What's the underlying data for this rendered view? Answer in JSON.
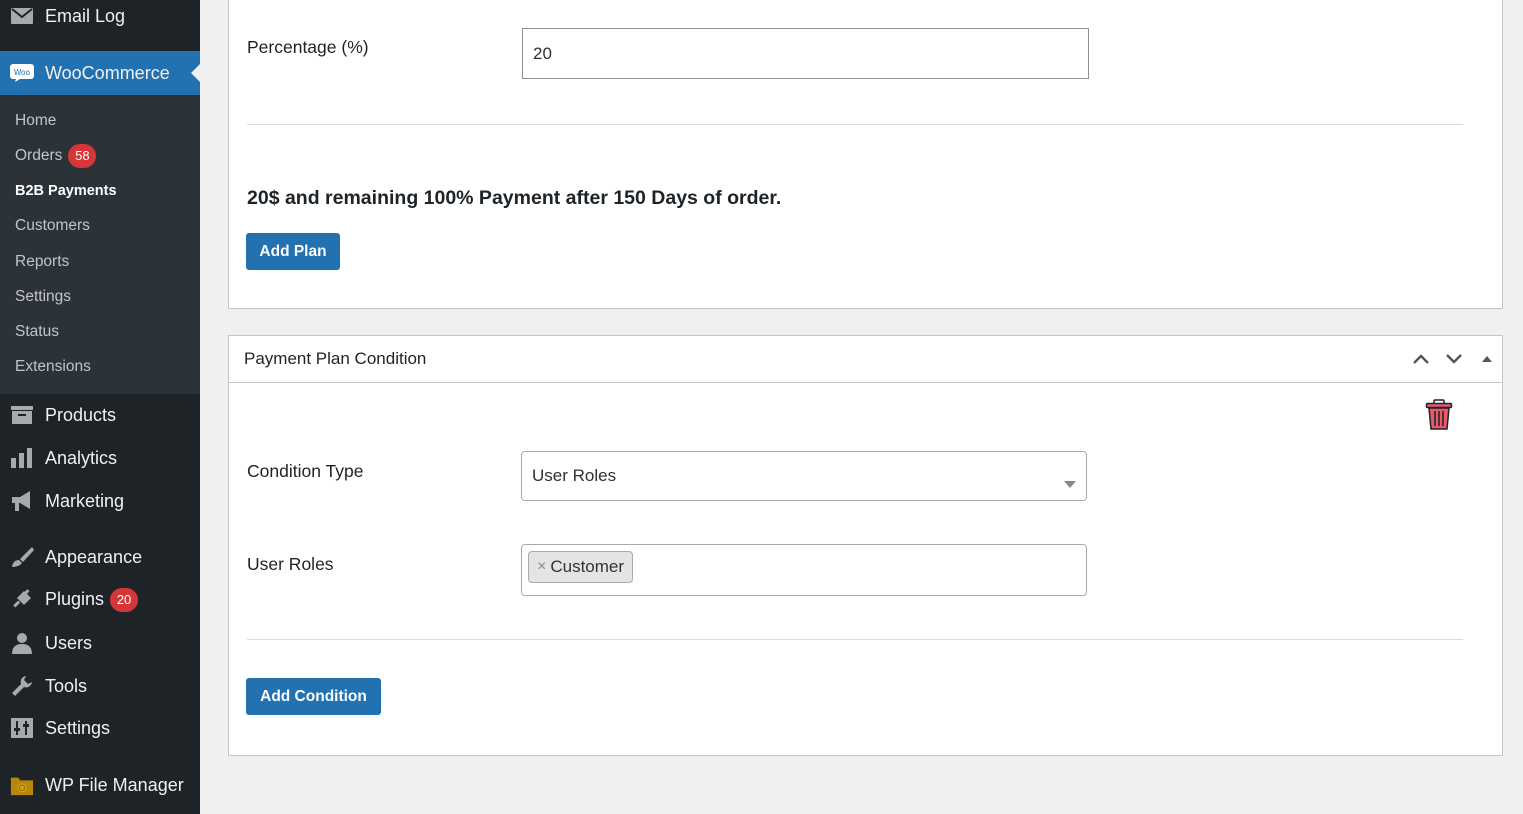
{
  "sidebar": {
    "top_items": [
      {
        "label": "Email Log",
        "icon": "envelope-icon"
      },
      {
        "label": "WooCommerce",
        "icon": "woo-icon"
      }
    ],
    "woo_icon_text": "Woo",
    "woocommerce_submenu": [
      {
        "label": "Home"
      },
      {
        "label": "Orders",
        "badge": "58"
      },
      {
        "label": "B2B Payments"
      },
      {
        "label": "Customers"
      },
      {
        "label": "Reports"
      },
      {
        "label": "Settings"
      },
      {
        "label": "Status"
      },
      {
        "label": "Extensions"
      }
    ],
    "bottom_items": [
      {
        "label": "Products",
        "icon": "archive-icon"
      },
      {
        "label": "Analytics",
        "icon": "bar-chart-icon"
      },
      {
        "label": "Marketing",
        "icon": "megaphone-icon"
      },
      {
        "label": "Appearance",
        "icon": "paintbrush-icon"
      },
      {
        "label": "Plugins",
        "icon": "plugin-icon",
        "badge": "20"
      },
      {
        "label": "Users",
        "icon": "user-icon"
      },
      {
        "label": "Tools",
        "icon": "wrench-icon"
      },
      {
        "label": "Settings",
        "icon": "settings-icon"
      },
      {
        "label": "WP File Manager",
        "icon": "file-manager-icon"
      }
    ]
  },
  "plan_panel": {
    "percentage_label": "Percentage (%)",
    "percentage_value": "20",
    "summary_text": "20$ and remaining 100% Payment after 150 Days of order.",
    "add_plan_label": "Add Plan"
  },
  "condition_panel": {
    "title": "Payment Plan Condition",
    "condition_type_label": "Condition Type",
    "condition_type_value": "User Roles",
    "user_roles_label": "User Roles",
    "user_roles_selected": [
      "Customer"
    ],
    "tag_remove_glyph": "×",
    "add_condition_label": "Add Condition"
  },
  "colors": {
    "sidebar_bg": "#1d2327",
    "submenu_bg": "#2c3338",
    "accent": "#2271b1",
    "badge": "#d63638",
    "delete_icon": "#d63638"
  }
}
